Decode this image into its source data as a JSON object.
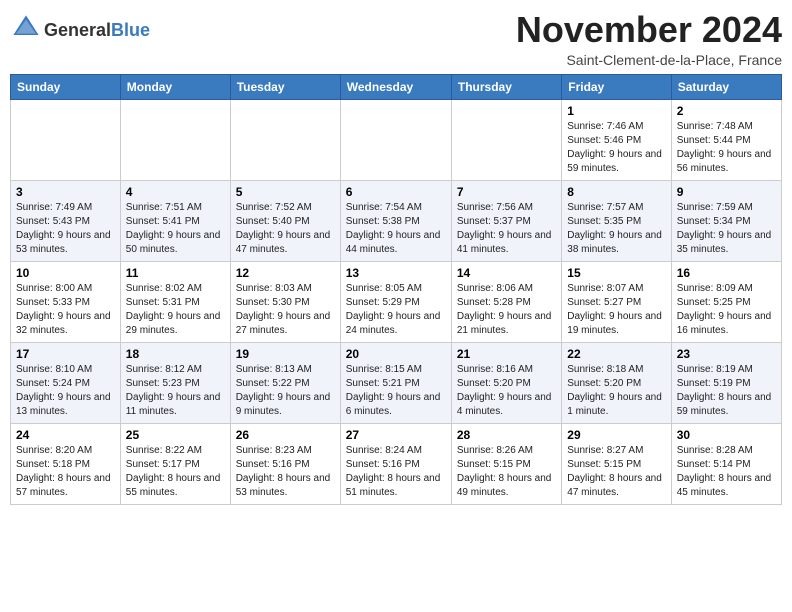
{
  "logo": {
    "general": "General",
    "blue": "Blue"
  },
  "title": "November 2024",
  "location": "Saint-Clement-de-la-Place, France",
  "days_of_week": [
    "Sunday",
    "Monday",
    "Tuesday",
    "Wednesday",
    "Thursday",
    "Friday",
    "Saturday"
  ],
  "weeks": [
    [
      {
        "day": "",
        "detail": ""
      },
      {
        "day": "",
        "detail": ""
      },
      {
        "day": "",
        "detail": ""
      },
      {
        "day": "",
        "detail": ""
      },
      {
        "day": "",
        "detail": ""
      },
      {
        "day": "1",
        "detail": "Sunrise: 7:46 AM\nSunset: 5:46 PM\nDaylight: 9 hours and 59 minutes."
      },
      {
        "day": "2",
        "detail": "Sunrise: 7:48 AM\nSunset: 5:44 PM\nDaylight: 9 hours and 56 minutes."
      }
    ],
    [
      {
        "day": "3",
        "detail": "Sunrise: 7:49 AM\nSunset: 5:43 PM\nDaylight: 9 hours and 53 minutes."
      },
      {
        "day": "4",
        "detail": "Sunrise: 7:51 AM\nSunset: 5:41 PM\nDaylight: 9 hours and 50 minutes."
      },
      {
        "day": "5",
        "detail": "Sunrise: 7:52 AM\nSunset: 5:40 PM\nDaylight: 9 hours and 47 minutes."
      },
      {
        "day": "6",
        "detail": "Sunrise: 7:54 AM\nSunset: 5:38 PM\nDaylight: 9 hours and 44 minutes."
      },
      {
        "day": "7",
        "detail": "Sunrise: 7:56 AM\nSunset: 5:37 PM\nDaylight: 9 hours and 41 minutes."
      },
      {
        "day": "8",
        "detail": "Sunrise: 7:57 AM\nSunset: 5:35 PM\nDaylight: 9 hours and 38 minutes."
      },
      {
        "day": "9",
        "detail": "Sunrise: 7:59 AM\nSunset: 5:34 PM\nDaylight: 9 hours and 35 minutes."
      }
    ],
    [
      {
        "day": "10",
        "detail": "Sunrise: 8:00 AM\nSunset: 5:33 PM\nDaylight: 9 hours and 32 minutes."
      },
      {
        "day": "11",
        "detail": "Sunrise: 8:02 AM\nSunset: 5:31 PM\nDaylight: 9 hours and 29 minutes."
      },
      {
        "day": "12",
        "detail": "Sunrise: 8:03 AM\nSunset: 5:30 PM\nDaylight: 9 hours and 27 minutes."
      },
      {
        "day": "13",
        "detail": "Sunrise: 8:05 AM\nSunset: 5:29 PM\nDaylight: 9 hours and 24 minutes."
      },
      {
        "day": "14",
        "detail": "Sunrise: 8:06 AM\nSunset: 5:28 PM\nDaylight: 9 hours and 21 minutes."
      },
      {
        "day": "15",
        "detail": "Sunrise: 8:07 AM\nSunset: 5:27 PM\nDaylight: 9 hours and 19 minutes."
      },
      {
        "day": "16",
        "detail": "Sunrise: 8:09 AM\nSunset: 5:25 PM\nDaylight: 9 hours and 16 minutes."
      }
    ],
    [
      {
        "day": "17",
        "detail": "Sunrise: 8:10 AM\nSunset: 5:24 PM\nDaylight: 9 hours and 13 minutes."
      },
      {
        "day": "18",
        "detail": "Sunrise: 8:12 AM\nSunset: 5:23 PM\nDaylight: 9 hours and 11 minutes."
      },
      {
        "day": "19",
        "detail": "Sunrise: 8:13 AM\nSunset: 5:22 PM\nDaylight: 9 hours and 9 minutes."
      },
      {
        "day": "20",
        "detail": "Sunrise: 8:15 AM\nSunset: 5:21 PM\nDaylight: 9 hours and 6 minutes."
      },
      {
        "day": "21",
        "detail": "Sunrise: 8:16 AM\nSunset: 5:20 PM\nDaylight: 9 hours and 4 minutes."
      },
      {
        "day": "22",
        "detail": "Sunrise: 8:18 AM\nSunset: 5:20 PM\nDaylight: 9 hours and 1 minute."
      },
      {
        "day": "23",
        "detail": "Sunrise: 8:19 AM\nSunset: 5:19 PM\nDaylight: 8 hours and 59 minutes."
      }
    ],
    [
      {
        "day": "24",
        "detail": "Sunrise: 8:20 AM\nSunset: 5:18 PM\nDaylight: 8 hours and 57 minutes."
      },
      {
        "day": "25",
        "detail": "Sunrise: 8:22 AM\nSunset: 5:17 PM\nDaylight: 8 hours and 55 minutes."
      },
      {
        "day": "26",
        "detail": "Sunrise: 8:23 AM\nSunset: 5:16 PM\nDaylight: 8 hours and 53 minutes."
      },
      {
        "day": "27",
        "detail": "Sunrise: 8:24 AM\nSunset: 5:16 PM\nDaylight: 8 hours and 51 minutes."
      },
      {
        "day": "28",
        "detail": "Sunrise: 8:26 AM\nSunset: 5:15 PM\nDaylight: 8 hours and 49 minutes."
      },
      {
        "day": "29",
        "detail": "Sunrise: 8:27 AM\nSunset: 5:15 PM\nDaylight: 8 hours and 47 minutes."
      },
      {
        "day": "30",
        "detail": "Sunrise: 8:28 AM\nSunset: 5:14 PM\nDaylight: 8 hours and 45 minutes."
      }
    ]
  ]
}
